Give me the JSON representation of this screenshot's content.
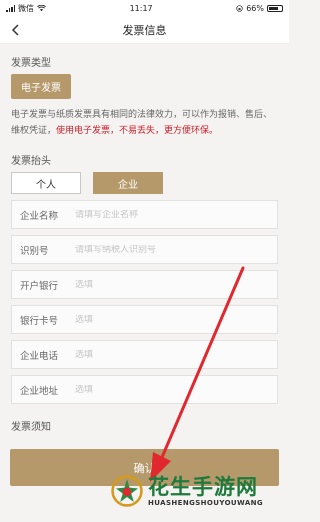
{
  "status_bar": {
    "carrier": "微信",
    "time": "11:17",
    "battery": "66%"
  },
  "nav": {
    "title": "发票信息"
  },
  "invoice_type": {
    "label": "发票类型",
    "selected": "电子发票"
  },
  "notice": {
    "normal": "电子发票与纸质发票具有相同的法律效力，可以作为报销、售后、维权凭证，",
    "highlight": "使用电子发票，不易丢失，更方便环保。"
  },
  "invoice_title": {
    "label": "发票抬头",
    "options": [
      "个人",
      "企业"
    ],
    "selected": "企业"
  },
  "fields": [
    {
      "label": "企业名称",
      "placeholder": "请填写企业名称"
    },
    {
      "label": "识别号",
      "placeholder": "请填写纳税人识别号"
    },
    {
      "label": "开户银行",
      "placeholder": "选填"
    },
    {
      "label": "银行卡号",
      "placeholder": "选填"
    },
    {
      "label": "企业电话",
      "placeholder": "选填"
    },
    {
      "label": "企业地址",
      "placeholder": "选填"
    }
  ],
  "notice_title": "发票须知",
  "submit": {
    "label": "确认"
  },
  "watermark": {
    "text_cn": "花生手游网",
    "text_en": "HUASHENGSHOUYOUWANG"
  },
  "colors": {
    "accent": "#b5996b",
    "highlight": "#d0202a",
    "arrow": "#e0282e",
    "watermark_green": "#1e7a3c"
  }
}
